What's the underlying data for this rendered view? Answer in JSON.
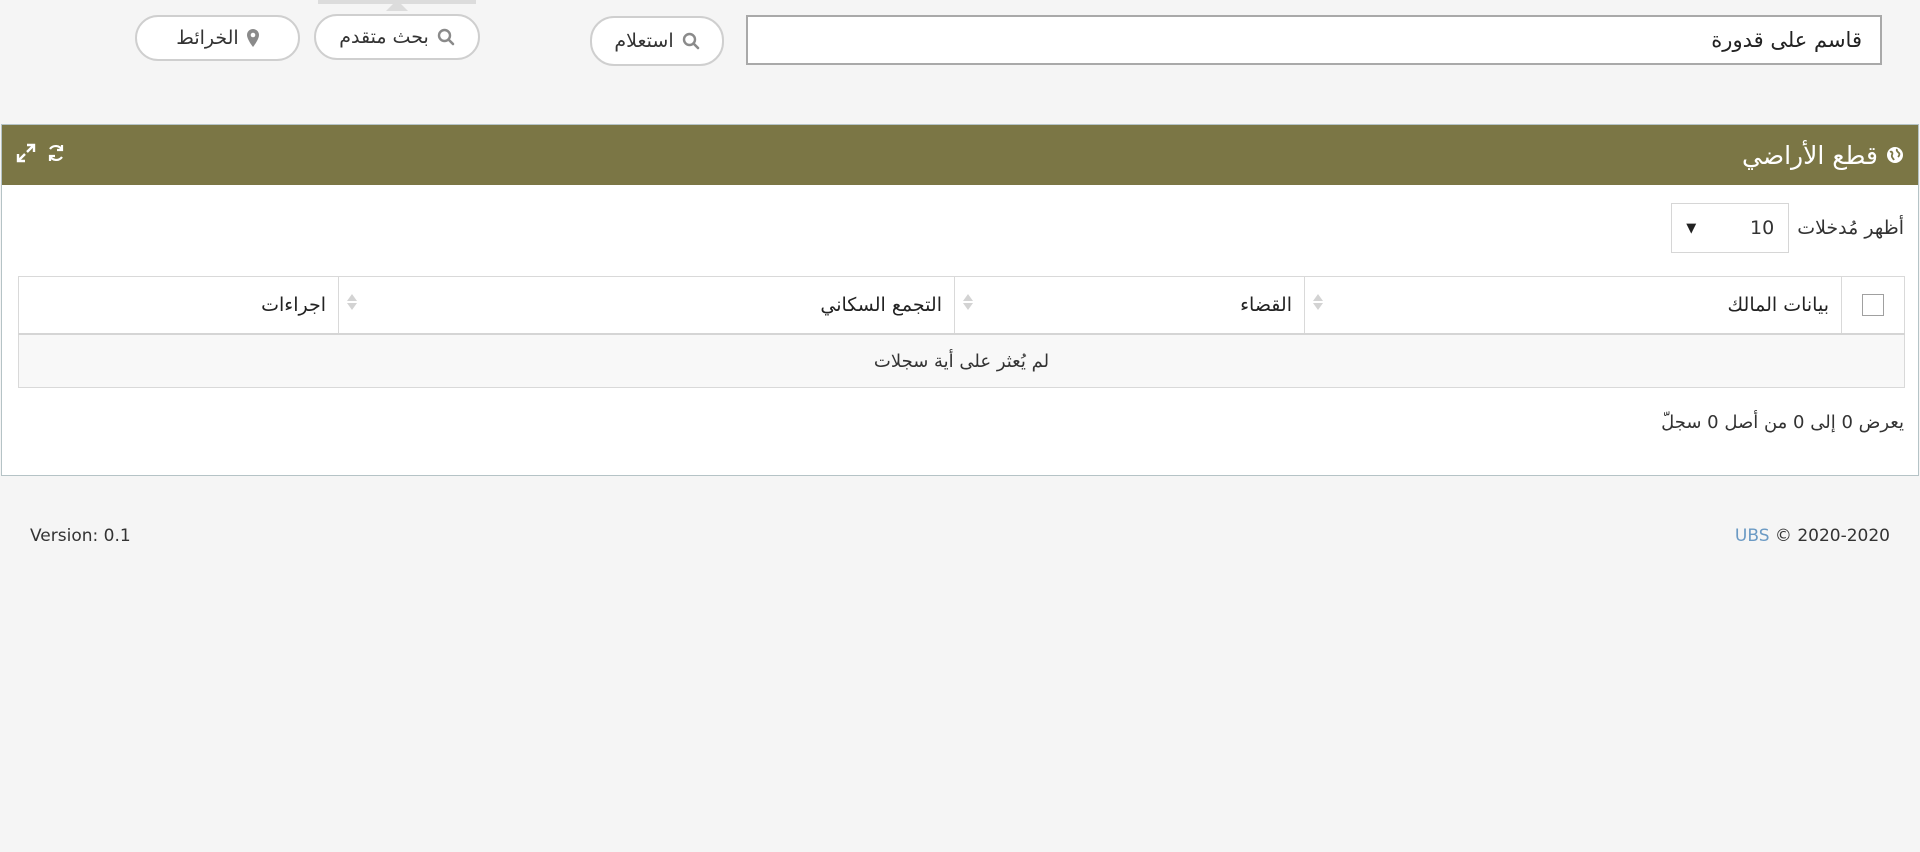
{
  "search": {
    "value": "قاسم على قدورة",
    "placeholder": ""
  },
  "toolbar": {
    "inquiry_label": "استعلام",
    "advanced_label": "بحث متقدم",
    "maps_label": "الخرائط"
  },
  "panel": {
    "title": "قطع الأراضي",
    "length_label": "أظهر مُدخلات",
    "length_value": "10",
    "columns": [
      "بيانات المالك",
      "القضاء",
      "التجمع السكاني",
      "اجراءات"
    ],
    "empty_message": "لم يُعثر على أية سجلات",
    "info": "يعرض 0 إلى 0 من أصل 0 سجلّ"
  },
  "footer": {
    "version": "Version: 0.1",
    "brand": "UBS",
    "copyright": "© 2020-2020"
  },
  "colors": {
    "panel_header": "#7b7645",
    "link": "#6b9ac4",
    "background": "#f5f5f5"
  }
}
